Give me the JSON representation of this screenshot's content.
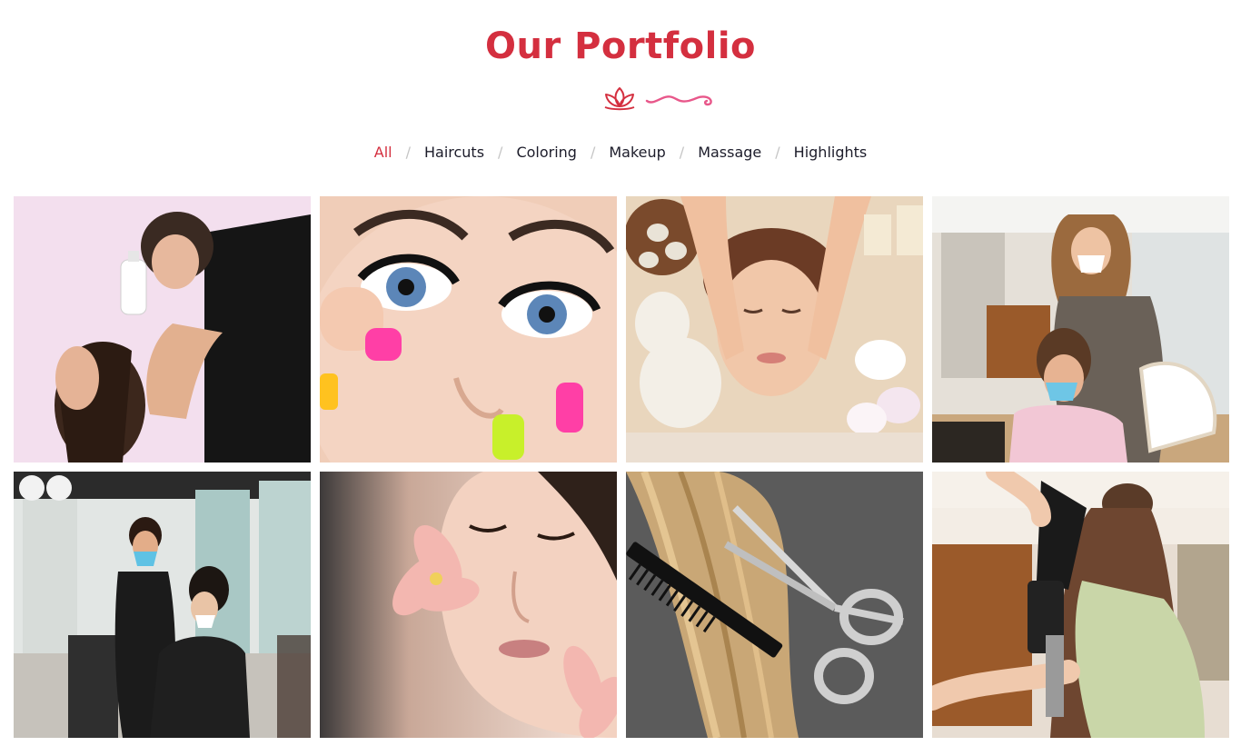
{
  "portfolio": {
    "title": "Our Portfolio",
    "filters": [
      {
        "label": "All",
        "active": true
      },
      {
        "label": "Haircuts",
        "active": false
      },
      {
        "label": "Coloring",
        "active": false
      },
      {
        "label": "Makeup",
        "active": false
      },
      {
        "label": "Massage",
        "active": false
      },
      {
        "label": "Highlights",
        "active": false
      }
    ],
    "separator": "/",
    "colors": {
      "accent": "#d42f3f",
      "ornament": "#e8578a",
      "text": "#1c1c2a"
    }
  }
}
